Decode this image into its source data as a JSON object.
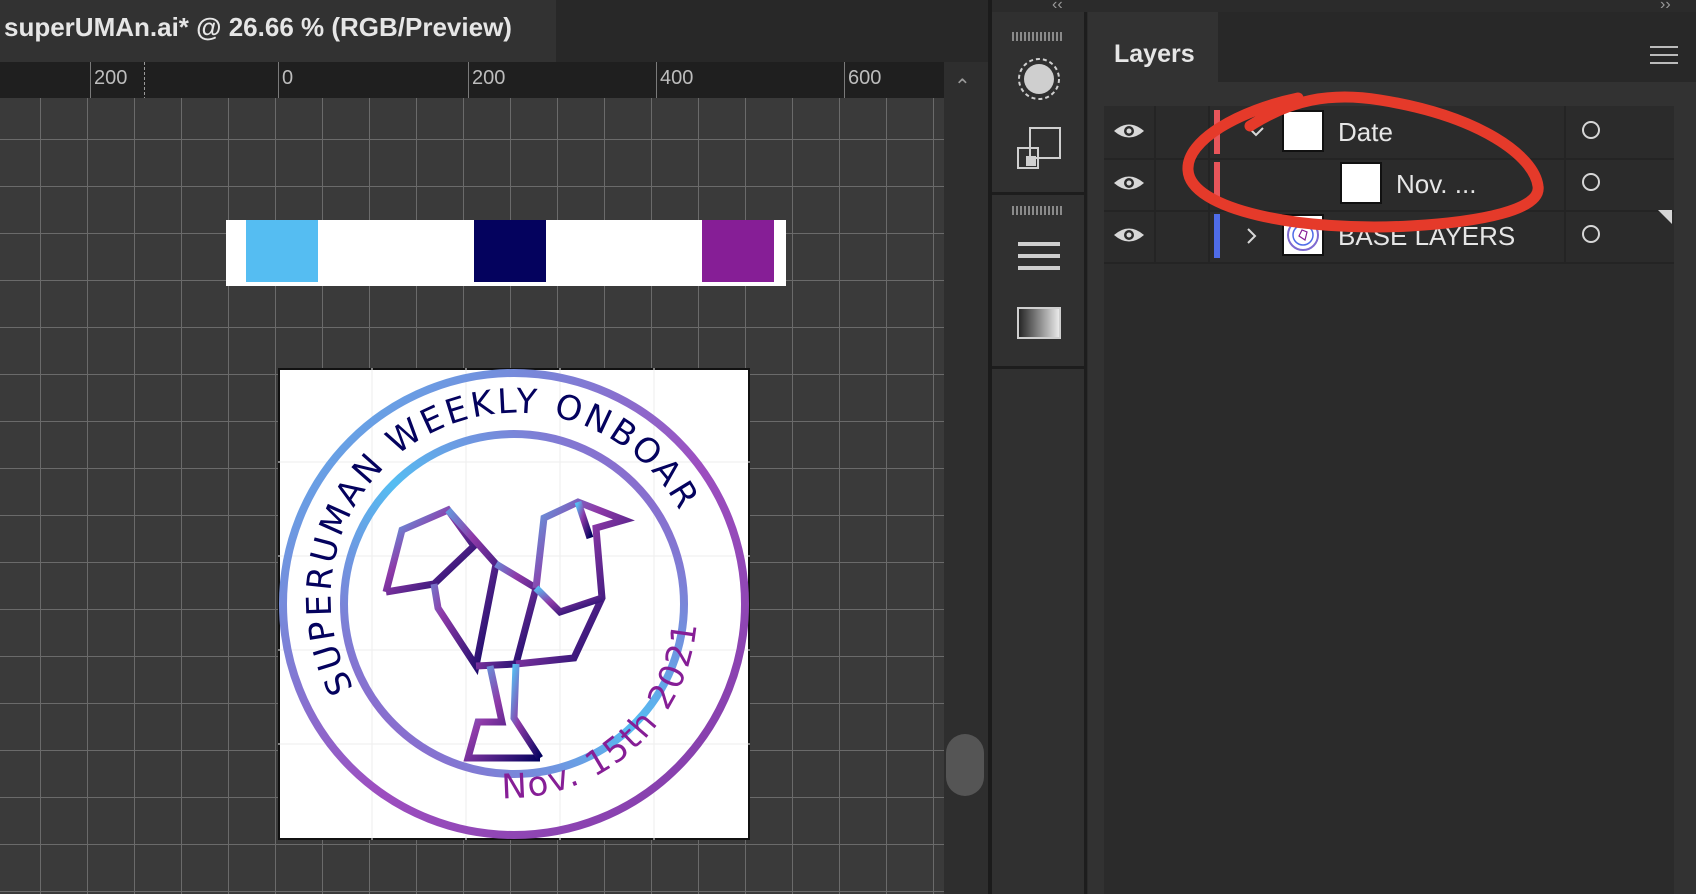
{
  "document": {
    "tab_title": "superUMAn.ai* @ 26.66 % (RGB/Preview)"
  },
  "ruler": {
    "labels": [
      "200",
      "0",
      "200",
      "400",
      "600"
    ]
  },
  "swatches": {
    "colors": [
      "#55bdf2",
      "#04025e",
      "#861e96"
    ]
  },
  "artwork": {
    "ring_text": "SUPERUMAN WEEKLY ONBOARDING",
    "date_text": "Nov. 15th 2021",
    "gradient": [
      "#55bdf2",
      "#9d4fc0",
      "#7e3aa6"
    ],
    "text_color_dark": "#04025e",
    "text_color_purple": "#861e96"
  },
  "layers_panel": {
    "title": "Layers",
    "layers": [
      {
        "name": "Date",
        "color": "#e8555a",
        "expanded": true,
        "indent": 0
      },
      {
        "name": "Nov. ...",
        "color": "#e8555a",
        "expanded": false,
        "indent": 1
      },
      {
        "name": "BASE LAYERS",
        "color": "#4f6ce8",
        "expanded": false,
        "indent": 0
      }
    ]
  },
  "annotation": {
    "color": "#e53a2a"
  }
}
